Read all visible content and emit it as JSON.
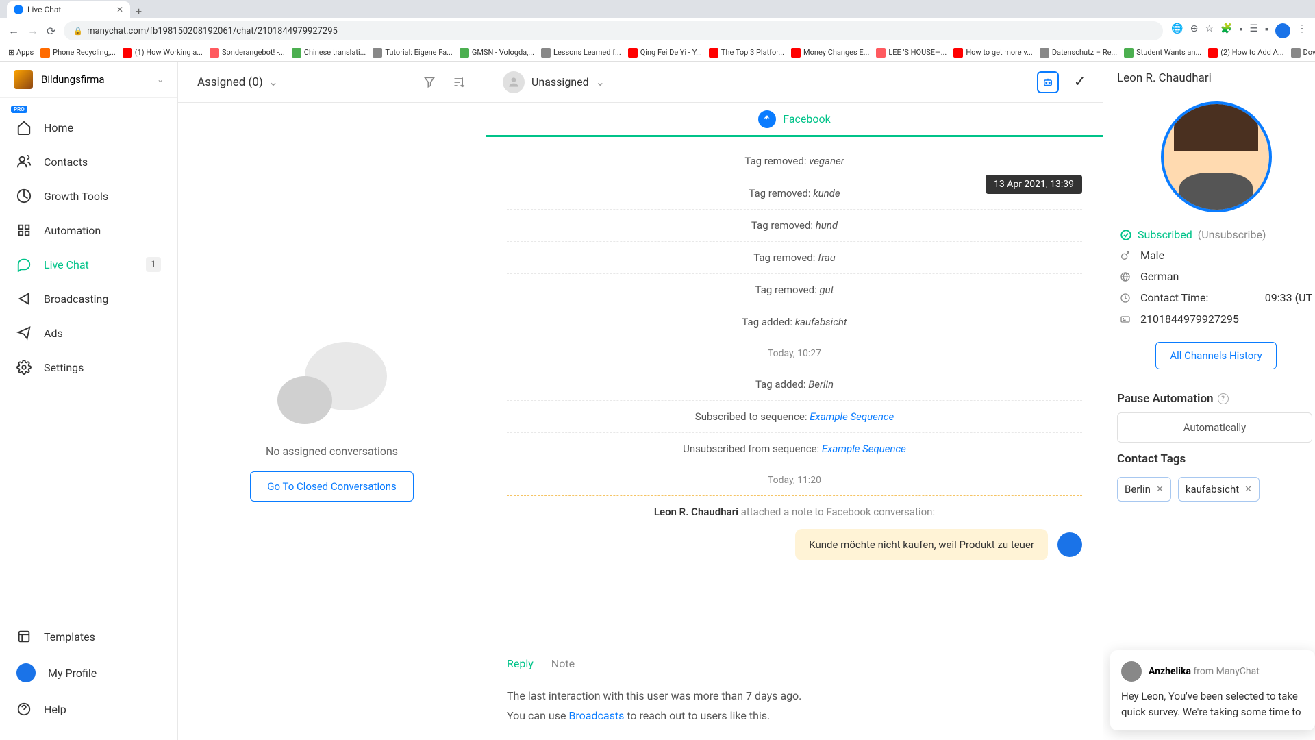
{
  "browser": {
    "tab_title": "Live Chat",
    "url": "manychat.com/fb198150208192061/chat/2101844979927295",
    "bookmarks": [
      {
        "label": "Apps",
        "color": "#5f6368"
      },
      {
        "label": "Phone Recycling,...",
        "color": "#ff6b00"
      },
      {
        "label": "(1) How Working a...",
        "color": "#ff0000"
      },
      {
        "label": "Sonderangebot! -...",
        "color": "#ff5a5f"
      },
      {
        "label": "Chinese translati...",
        "color": "#4caf50"
      },
      {
        "label": "Tutorial: Eigene Fa...",
        "color": "#888"
      },
      {
        "label": "GMSN - Vologda,...",
        "color": "#4caf50"
      },
      {
        "label": "Lessons Learned f...",
        "color": "#888"
      },
      {
        "label": "Qing Fei De Yi - Y...",
        "color": "#ff0000"
      },
      {
        "label": "The Top 3 Platfor...",
        "color": "#ff0000"
      },
      {
        "label": "Money Changes E...",
        "color": "#ff0000"
      },
      {
        "label": "LEE 'S HOUSE—...",
        "color": "#ff5a5f"
      },
      {
        "label": "How to get more v...",
        "color": "#ff0000"
      },
      {
        "label": "Datenschutz – Re...",
        "color": "#888"
      },
      {
        "label": "Student Wants an...",
        "color": "#4caf50"
      },
      {
        "label": "(2) How to Add A...",
        "color": "#ff0000"
      },
      {
        "label": "Download – Cooki...",
        "color": "#888"
      }
    ]
  },
  "org": {
    "name": "Bildungsfirma",
    "badge": "PRO"
  },
  "nav": {
    "items": [
      {
        "label": "Home"
      },
      {
        "label": "Contacts"
      },
      {
        "label": "Growth Tools"
      },
      {
        "label": "Automation"
      },
      {
        "label": "Live Chat",
        "active": true,
        "badge": "1"
      },
      {
        "label": "Broadcasting"
      },
      {
        "label": "Ads"
      },
      {
        "label": "Settings"
      }
    ],
    "bottom": [
      {
        "label": "Templates"
      },
      {
        "label": "My Profile"
      },
      {
        "label": "Help"
      }
    ]
  },
  "conversations": {
    "header": "Assigned (0)",
    "empty_text": "No assigned conversations",
    "closed_btn": "Go To Closed Conversations"
  },
  "chat": {
    "assignee": "Unassigned",
    "channel": "Facebook",
    "timestamp_tooltip": "13 Apr 2021, 13:39",
    "events": [
      {
        "type": "tag_removed",
        "prefix": "Tag removed: ",
        "value": "veganer"
      },
      {
        "type": "tag_removed",
        "prefix": "Tag removed: ",
        "value": "kunde"
      },
      {
        "type": "tag_removed",
        "prefix": "Tag removed: ",
        "value": "hund"
      },
      {
        "type": "tag_removed",
        "prefix": "Tag removed: ",
        "value": "frau"
      },
      {
        "type": "tag_removed",
        "prefix": "Tag removed: ",
        "value": "gut"
      },
      {
        "type": "tag_added",
        "prefix": "Tag added: ",
        "value": "kaufabsicht"
      }
    ],
    "time1": "Today, 10:27",
    "events2": [
      {
        "type": "tag_added",
        "prefix": "Tag added: ",
        "value": "Berlin"
      },
      {
        "type": "sequence_sub",
        "prefix": "Subscribed to sequence: ",
        "value": "Example Sequence"
      },
      {
        "type": "sequence_unsub",
        "prefix": "Unsubscribed from sequence: ",
        "value": "Example Sequence"
      }
    ],
    "time2": "Today, 11:20",
    "note": {
      "author": "Leon R. Chaudhari",
      "action": " attached a note to Facebook conversation:",
      "text": "Kunde möchte nicht kaufen, weil Produkt zu teuer"
    },
    "reply_tabs": {
      "reply": "Reply",
      "note": "Note"
    },
    "info_line1": "The last interaction with this user was more than 7 days ago.",
    "info_line2_pre": "You can use ",
    "info_line2_link": "Broadcasts",
    "info_line2_post": " to reach out to users like this."
  },
  "contact": {
    "name": "Leon R. Chaudhari",
    "subscribed": "Subscribed",
    "unsubscribe": "(Unsubscribe)",
    "gender": "Male",
    "locale": "German",
    "contact_time_label": "Contact Time:",
    "contact_time_value": "09:33 (UT",
    "id": "2101844979927295",
    "history_btn": "All Channels History",
    "pause_title": "Pause Automation",
    "pause_value": "Automatically",
    "tags_title": "Contact Tags",
    "tags": [
      "Berlin",
      "kaufabsicht"
    ]
  },
  "toast": {
    "name": "Anzhelika",
    "from": " from ManyChat",
    "body": "Hey Leon,  You've been selected to take quick survey. We're taking some time to"
  }
}
